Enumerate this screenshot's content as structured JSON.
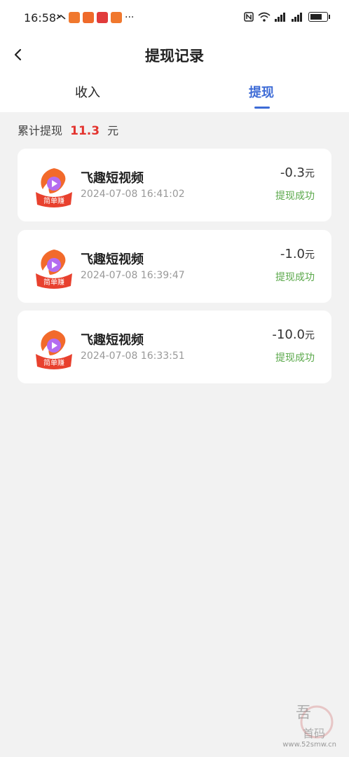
{
  "status_bar": {
    "time": "16:58",
    "icons": [
      "missed-call-icon",
      "app-icon-1",
      "app-icon-2",
      "app-icon-3",
      "more-icon",
      "nfc-icon",
      "wifi-icon",
      "signal-4g-icon",
      "signal-5g-icon",
      "battery-icon"
    ]
  },
  "header": {
    "title": "提现记录",
    "tabs": [
      {
        "label": "收入",
        "active": false
      },
      {
        "label": "提现",
        "active": true
      }
    ]
  },
  "summary": {
    "label": "累计提现",
    "amount": "11.3",
    "unit": "元"
  },
  "records": [
    {
      "app_name": "飞趣短视频",
      "datetime": "2024-07-08 16:41:02",
      "amount": "-0.3",
      "unit": "元",
      "status": "提现成功"
    },
    {
      "app_name": "飞趣短视频",
      "datetime": "2024-07-08 16:39:47",
      "amount": "-1.0",
      "unit": "元",
      "status": "提现成功"
    },
    {
      "app_name": "飞趣短视频",
      "datetime": "2024-07-08 16:33:51",
      "amount": "-10.0",
      "unit": "元",
      "status": "提现成功"
    }
  ],
  "watermark": {
    "text": "www.52smw.cn"
  },
  "colors": {
    "accent": "#3d6bd6",
    "amount_red": "#e3342f",
    "success_green": "#5aa84a"
  }
}
